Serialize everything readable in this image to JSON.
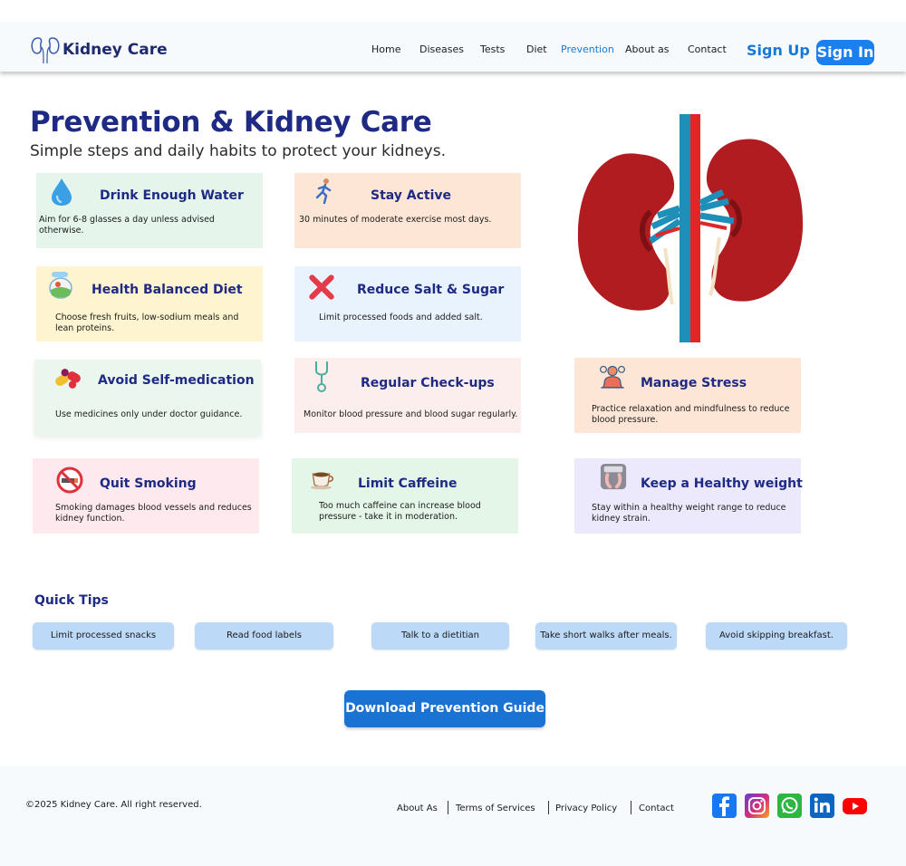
{
  "brand": {
    "name": "Kidney Care"
  },
  "nav": {
    "links": [
      "Home",
      "Diseases",
      "Tests",
      "Diet",
      "Prevention",
      "About as",
      "Contact"
    ],
    "active": "Prevention",
    "sign_up": "Sign Up",
    "sign_in": "Sign In"
  },
  "hero": {
    "title": "Prevention & Kidney Care",
    "subtitle": "Simple steps and daily habits to protect your kidneys."
  },
  "cards": [
    {
      "title": "Drink Enough Water",
      "text": "Aim for 6-8 glasses a day unless advised otherwise.",
      "icon": "water-drop-icon",
      "bg": "#e5f5ec"
    },
    {
      "title": "Stay Active",
      "text": "30 minutes of moderate exercise most days.",
      "icon": "runner-icon",
      "bg": "#fde6d6"
    },
    {
      "title": "Health Balanced Diet",
      "text": "Choose fresh fruits, low-sodium meals and lean proteins.",
      "icon": "food-icon",
      "bg": "#fef4cf"
    },
    {
      "title": "Reduce Salt & Sugar",
      "text": "Limit processed foods and added salt.",
      "icon": "cross-icon",
      "bg": "#e9f3fe"
    },
    {
      "title": "Avoid Self-medication",
      "text": "Use medicines only under doctor guidance.",
      "icon": "pills-icon",
      "bg": "#eaf6ee"
    },
    {
      "title": "Regular Check-ups",
      "text": "Monitor blood pressure and blood sugar regularly.",
      "icon": "stethoscope-icon",
      "bg": "#fdeeee"
    },
    {
      "title": "Manage Stress",
      "text": "Practice relaxation and mindfulness to reduce blood pressure.",
      "icon": "meditation-icon",
      "bg": "#fde6d6"
    },
    {
      "title": "Quit Smoking",
      "text": "Smoking damages blood vessels and reduces kidney function.",
      "icon": "no-smoking-icon",
      "bg": "#fde9ee"
    },
    {
      "title": "Limit Caffeine",
      "text": "Too much caffeine can increase blood pressure - take it in moderation.",
      "icon": "coffee-cup-icon",
      "bg": "#e3f6e8"
    },
    {
      "title": "Keep a Healthy weight",
      "text": "Stay within a healthy weight range to reduce kidney strain.",
      "icon": "scale-icon",
      "bg": "#ece9fc"
    }
  ],
  "quick_tips": {
    "title": "Quick Tips",
    "items": [
      "Limit processed snacks",
      "Read food labels",
      "Talk to a dietitian",
      "Take short walks after meals.",
      "Avoid skipping breakfast."
    ]
  },
  "download_button": "Download Prevention Guide",
  "footer": {
    "copyright": "©2025 Kidney Care. All right reserved.",
    "links": [
      "About As",
      "Terms of Services",
      "Privacy Policy",
      "Contact"
    ],
    "social": [
      "facebook-icon",
      "instagram-icon",
      "whatsapp-icon",
      "linkedin-icon",
      "youtube-icon"
    ]
  },
  "colors": {
    "primary": "#1a80ef",
    "heading": "#1e2a84",
    "kidney": "#b01c1f"
  }
}
